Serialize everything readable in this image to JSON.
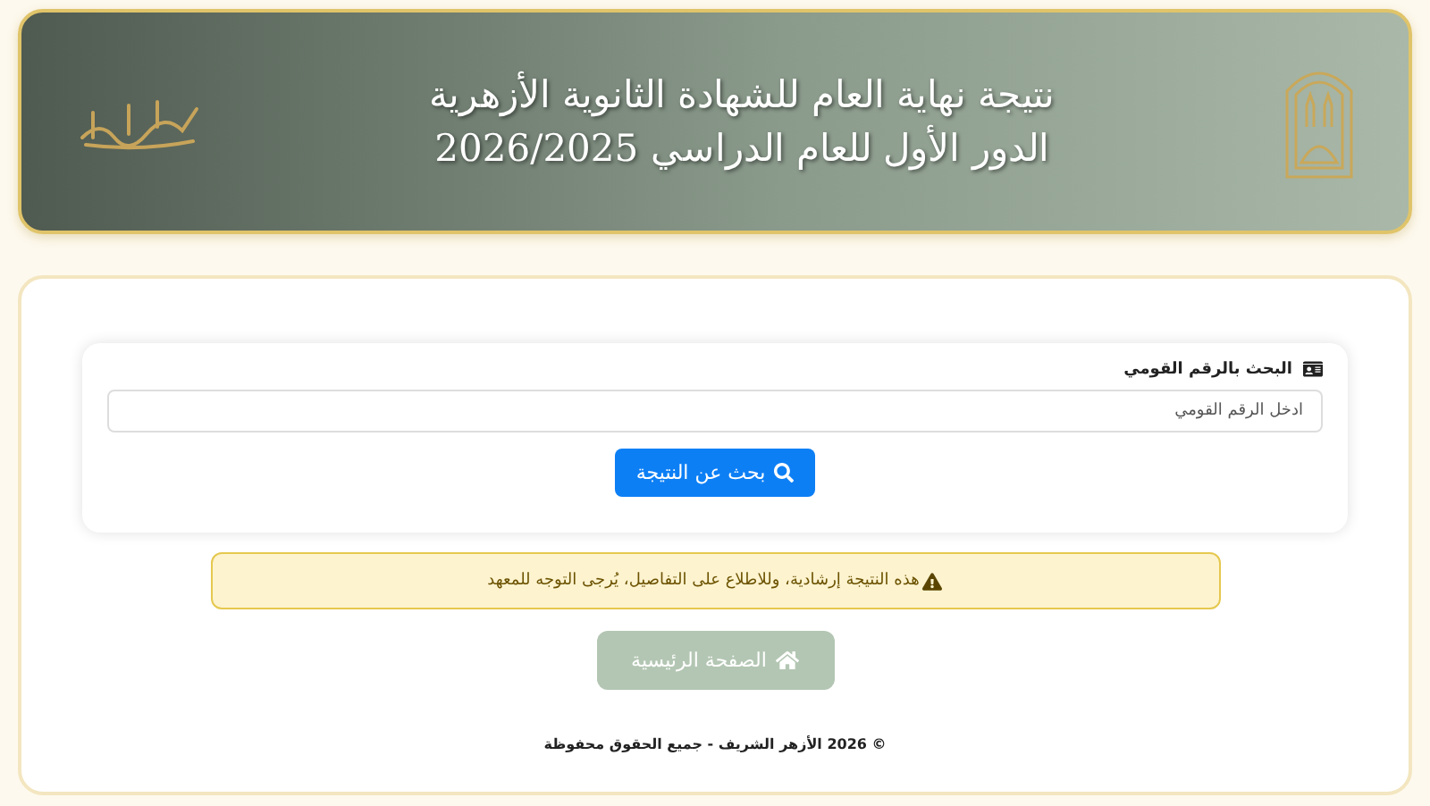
{
  "header": {
    "title_lines": [
      "نتيجة نهاية العام للشهادة الثانوية الأزهرية",
      "الدور الأول للعام الدراسي 2026/2025"
    ]
  },
  "search": {
    "label": "البحث بالرقم القومي",
    "placeholder": "ادخل الرقم القومي",
    "button": "بحث عن النتيجة"
  },
  "alert": {
    "text": "هذه النتيجة إرشادية، وللاطلاع على التفاصيل، يُرجى التوجه للمعهد"
  },
  "home_button": {
    "label": "الصفحة الرئيسية",
    "disabled": true
  },
  "footer": {
    "text": "© 2026 الأزهر الشريف - جميع الحقوق محفوظة"
  }
}
